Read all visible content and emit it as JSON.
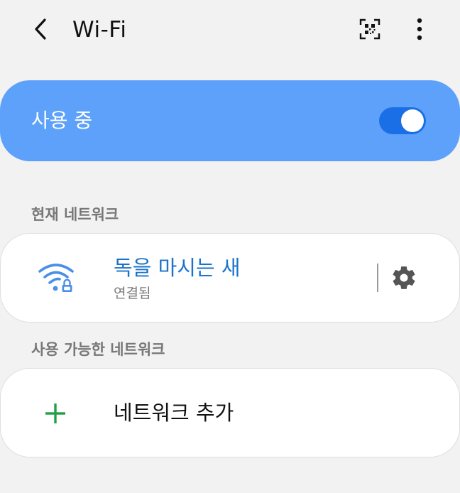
{
  "header": {
    "title": "Wi-Fi",
    "back_icon": "chevron-left-icon",
    "qr_icon": "qr-scan-icon",
    "more_icon": "more-vertical-icon"
  },
  "master_switch": {
    "label": "사용 중",
    "state": "on",
    "color": "#5ea1fb",
    "switch_color": "#1b6fe6"
  },
  "current_network": {
    "section_label": "현재 네트워크",
    "name": "독을 마시는 새",
    "status": "연결됨",
    "icon": "wifi-lock-icon",
    "settings_icon": "gear-icon",
    "name_color": "#1a73c9"
  },
  "available_networks": {
    "section_label": "사용 가능한 네트워크",
    "add_label": "네트워크 추가",
    "add_icon": "plus-icon",
    "add_icon_color": "#22a046"
  }
}
